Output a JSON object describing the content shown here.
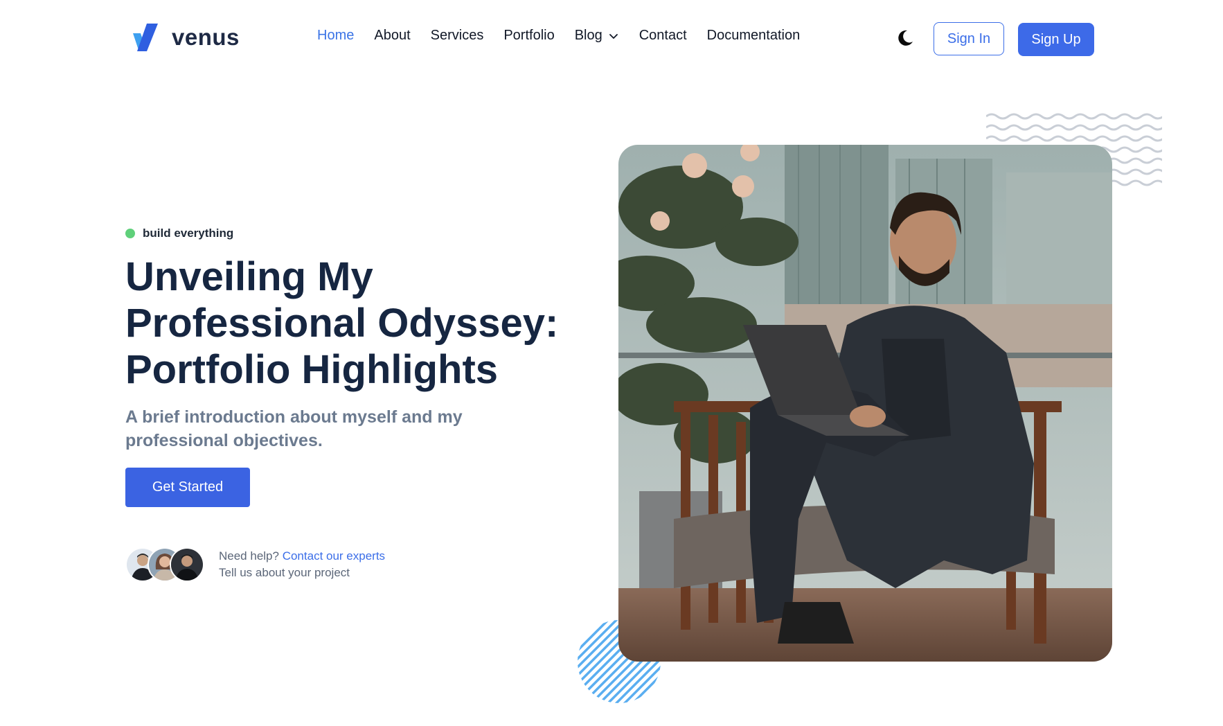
{
  "brand": {
    "name": "venus",
    "logo_colors": [
      "#3ea0f0",
      "#2f5fe0"
    ]
  },
  "nav": {
    "items": [
      {
        "label": "Home",
        "active": true
      },
      {
        "label": "About"
      },
      {
        "label": "Services"
      },
      {
        "label": "Portfolio"
      },
      {
        "label": "Blog",
        "has_dropdown": true,
        "icon": "chevron-down-icon"
      },
      {
        "label": "Contact"
      },
      {
        "label": "Documentation"
      }
    ],
    "theme_toggle_icon": "moon-icon",
    "sign_in": "Sign In",
    "sign_up": "Sign Up"
  },
  "hero": {
    "tagline": "build everything",
    "title_lines": [
      "Unveiling My",
      "Professional Odyssey:",
      "Portfolio Highlights"
    ],
    "subtitle": "A brief introduction about myself and my professional objectives.",
    "cta": "Get Started",
    "help": {
      "prefix": "Need help?",
      "link": "Contact our experts",
      "line2": "Tell us about your project"
    },
    "image": "man-with-laptop-photo"
  },
  "colors": {
    "accent": "#3b63e2",
    "heading": "#162641",
    "subtitle": "#6b7a8f",
    "status_dot": "#5fd07a",
    "decor_stripes": "#5aaef0",
    "decor_waves": "#c9ced6"
  }
}
